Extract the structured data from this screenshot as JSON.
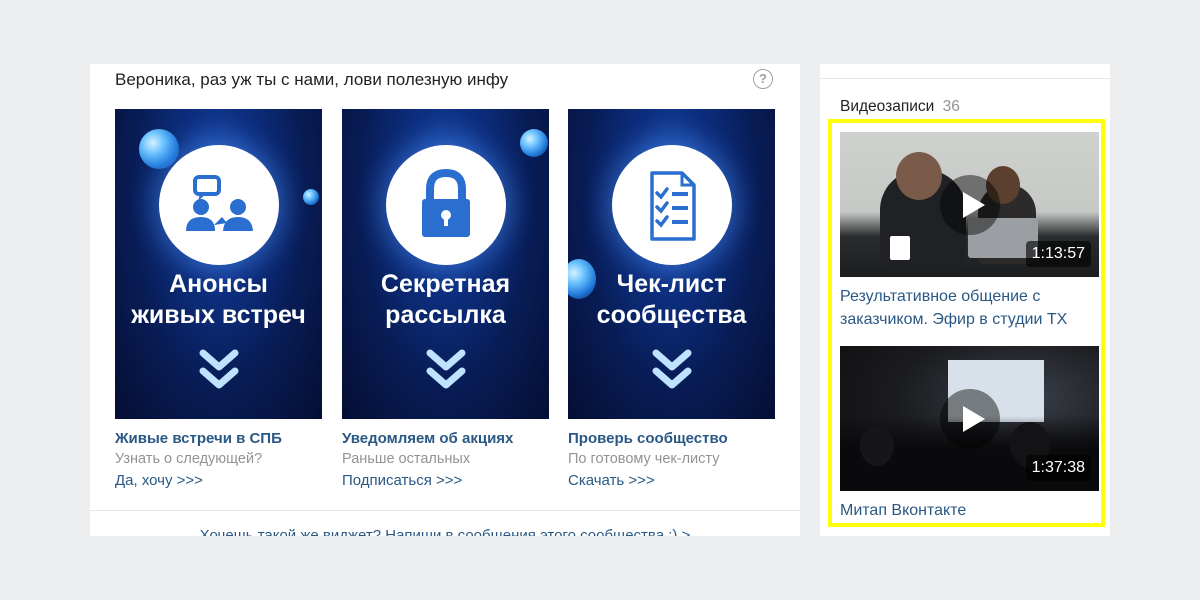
{
  "widget": {
    "title": "Вероника, раз уж ты с нами, лови полезную инфу",
    "help_icon": "?",
    "cards": [
      {
        "image_text_line1": "Анонсы",
        "image_text_line2": "живых встреч",
        "icon": "people-chat-icon",
        "title": "Живые встречи в СПБ",
        "subtitle": "Узнать о следующей?",
        "link": "Да, хочу >>>"
      },
      {
        "image_text_line1": "Секретная",
        "image_text_line2": "рассылка",
        "icon": "lock-icon",
        "title": "Уведомляем об акциях",
        "subtitle": "Раньше остальных",
        "link": "Подписаться >>>"
      },
      {
        "image_text_line1": "Чек-лист",
        "image_text_line2": "сообщества",
        "icon": "checklist-icon",
        "title": "Проверь сообщество",
        "subtitle": "По готовому чек-листу",
        "link": "Скачать >>>"
      }
    ],
    "footer": "Хочешь такой же виджет? Напиши в сообщения этого сообщества :) >"
  },
  "videos": {
    "header": "Видеозаписи",
    "count": "36",
    "items": [
      {
        "duration": "1:13:57",
        "title": "Результативное общение с заказчиком. Эфир в студии ТХ"
      },
      {
        "duration": "1:37:38",
        "title": "Митап Вконтакте"
      }
    ]
  },
  "colors": {
    "page_background": "#edeef0",
    "link_blue": "#2a5885",
    "muted_gray": "#939393",
    "highlight_yellow": "#ffff0a",
    "card_dark_blue": "#081c55"
  }
}
